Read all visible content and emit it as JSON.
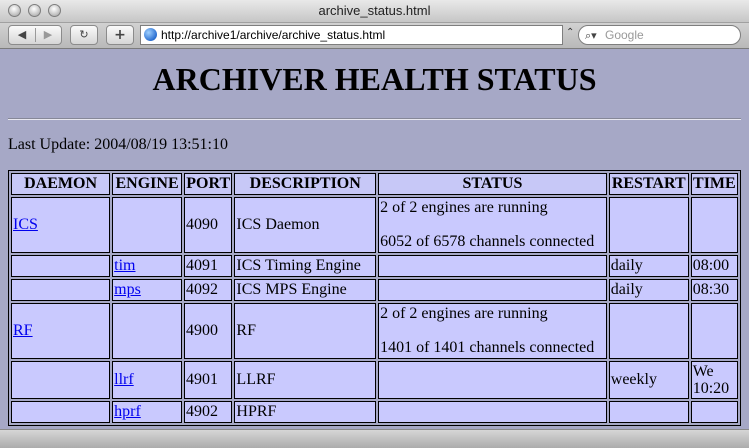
{
  "window": {
    "title": "archive_status.html"
  },
  "toolbar": {
    "back_icon": "◀",
    "forward_icon": "▶",
    "reload_icon": "↻",
    "add_icon": "+",
    "url": "http://archive1/archive/archive_status.html",
    "search_placeholder": "Google"
  },
  "page": {
    "title": "ARCHIVER HEALTH STATUS",
    "last_update": "Last Update: 2004/08/19 13:51:10"
  },
  "table": {
    "headers": [
      "DAEMON",
      "ENGINE",
      "PORT",
      "DESCRIPTION",
      "STATUS",
      "RESTART",
      "TIME"
    ],
    "rows": [
      {
        "daemon": "ICS",
        "engine": "",
        "port": "4090",
        "description": "ICS Daemon",
        "status1": "2 of 2 engines are running",
        "status2": "6052 of 6578 channels connected",
        "restart": "",
        "time": ""
      },
      {
        "daemon": "",
        "engine": "tim",
        "port": "4091",
        "description": "ICS Timing Engine",
        "status1": "",
        "status2": "",
        "restart": "daily",
        "time": "08:00"
      },
      {
        "daemon": "",
        "engine": "mps",
        "port": "4092",
        "description": "ICS MPS Engine",
        "status1": "",
        "status2": "",
        "restart": "daily",
        "time": "08:30"
      },
      {
        "daemon": "RF",
        "engine": "",
        "port": "4900",
        "description": "RF",
        "status1": "2 of 2 engines are running",
        "status2": "1401 of 1401 channels connected",
        "restart": "",
        "time": ""
      },
      {
        "daemon": "",
        "engine": "llrf",
        "port": "4901",
        "description": "LLRF",
        "status1": "",
        "status2": "",
        "restart": "weekly",
        "time": "We 10:20"
      },
      {
        "daemon": "",
        "engine": "hprf",
        "port": "4902",
        "description": "HPRF",
        "status1": "",
        "status2": "",
        "restart": "",
        "time": ""
      }
    ]
  },
  "colors": {
    "page_background": "#a6a8c6",
    "cell_background": "#c9c9fe",
    "link": "#0000ee"
  }
}
